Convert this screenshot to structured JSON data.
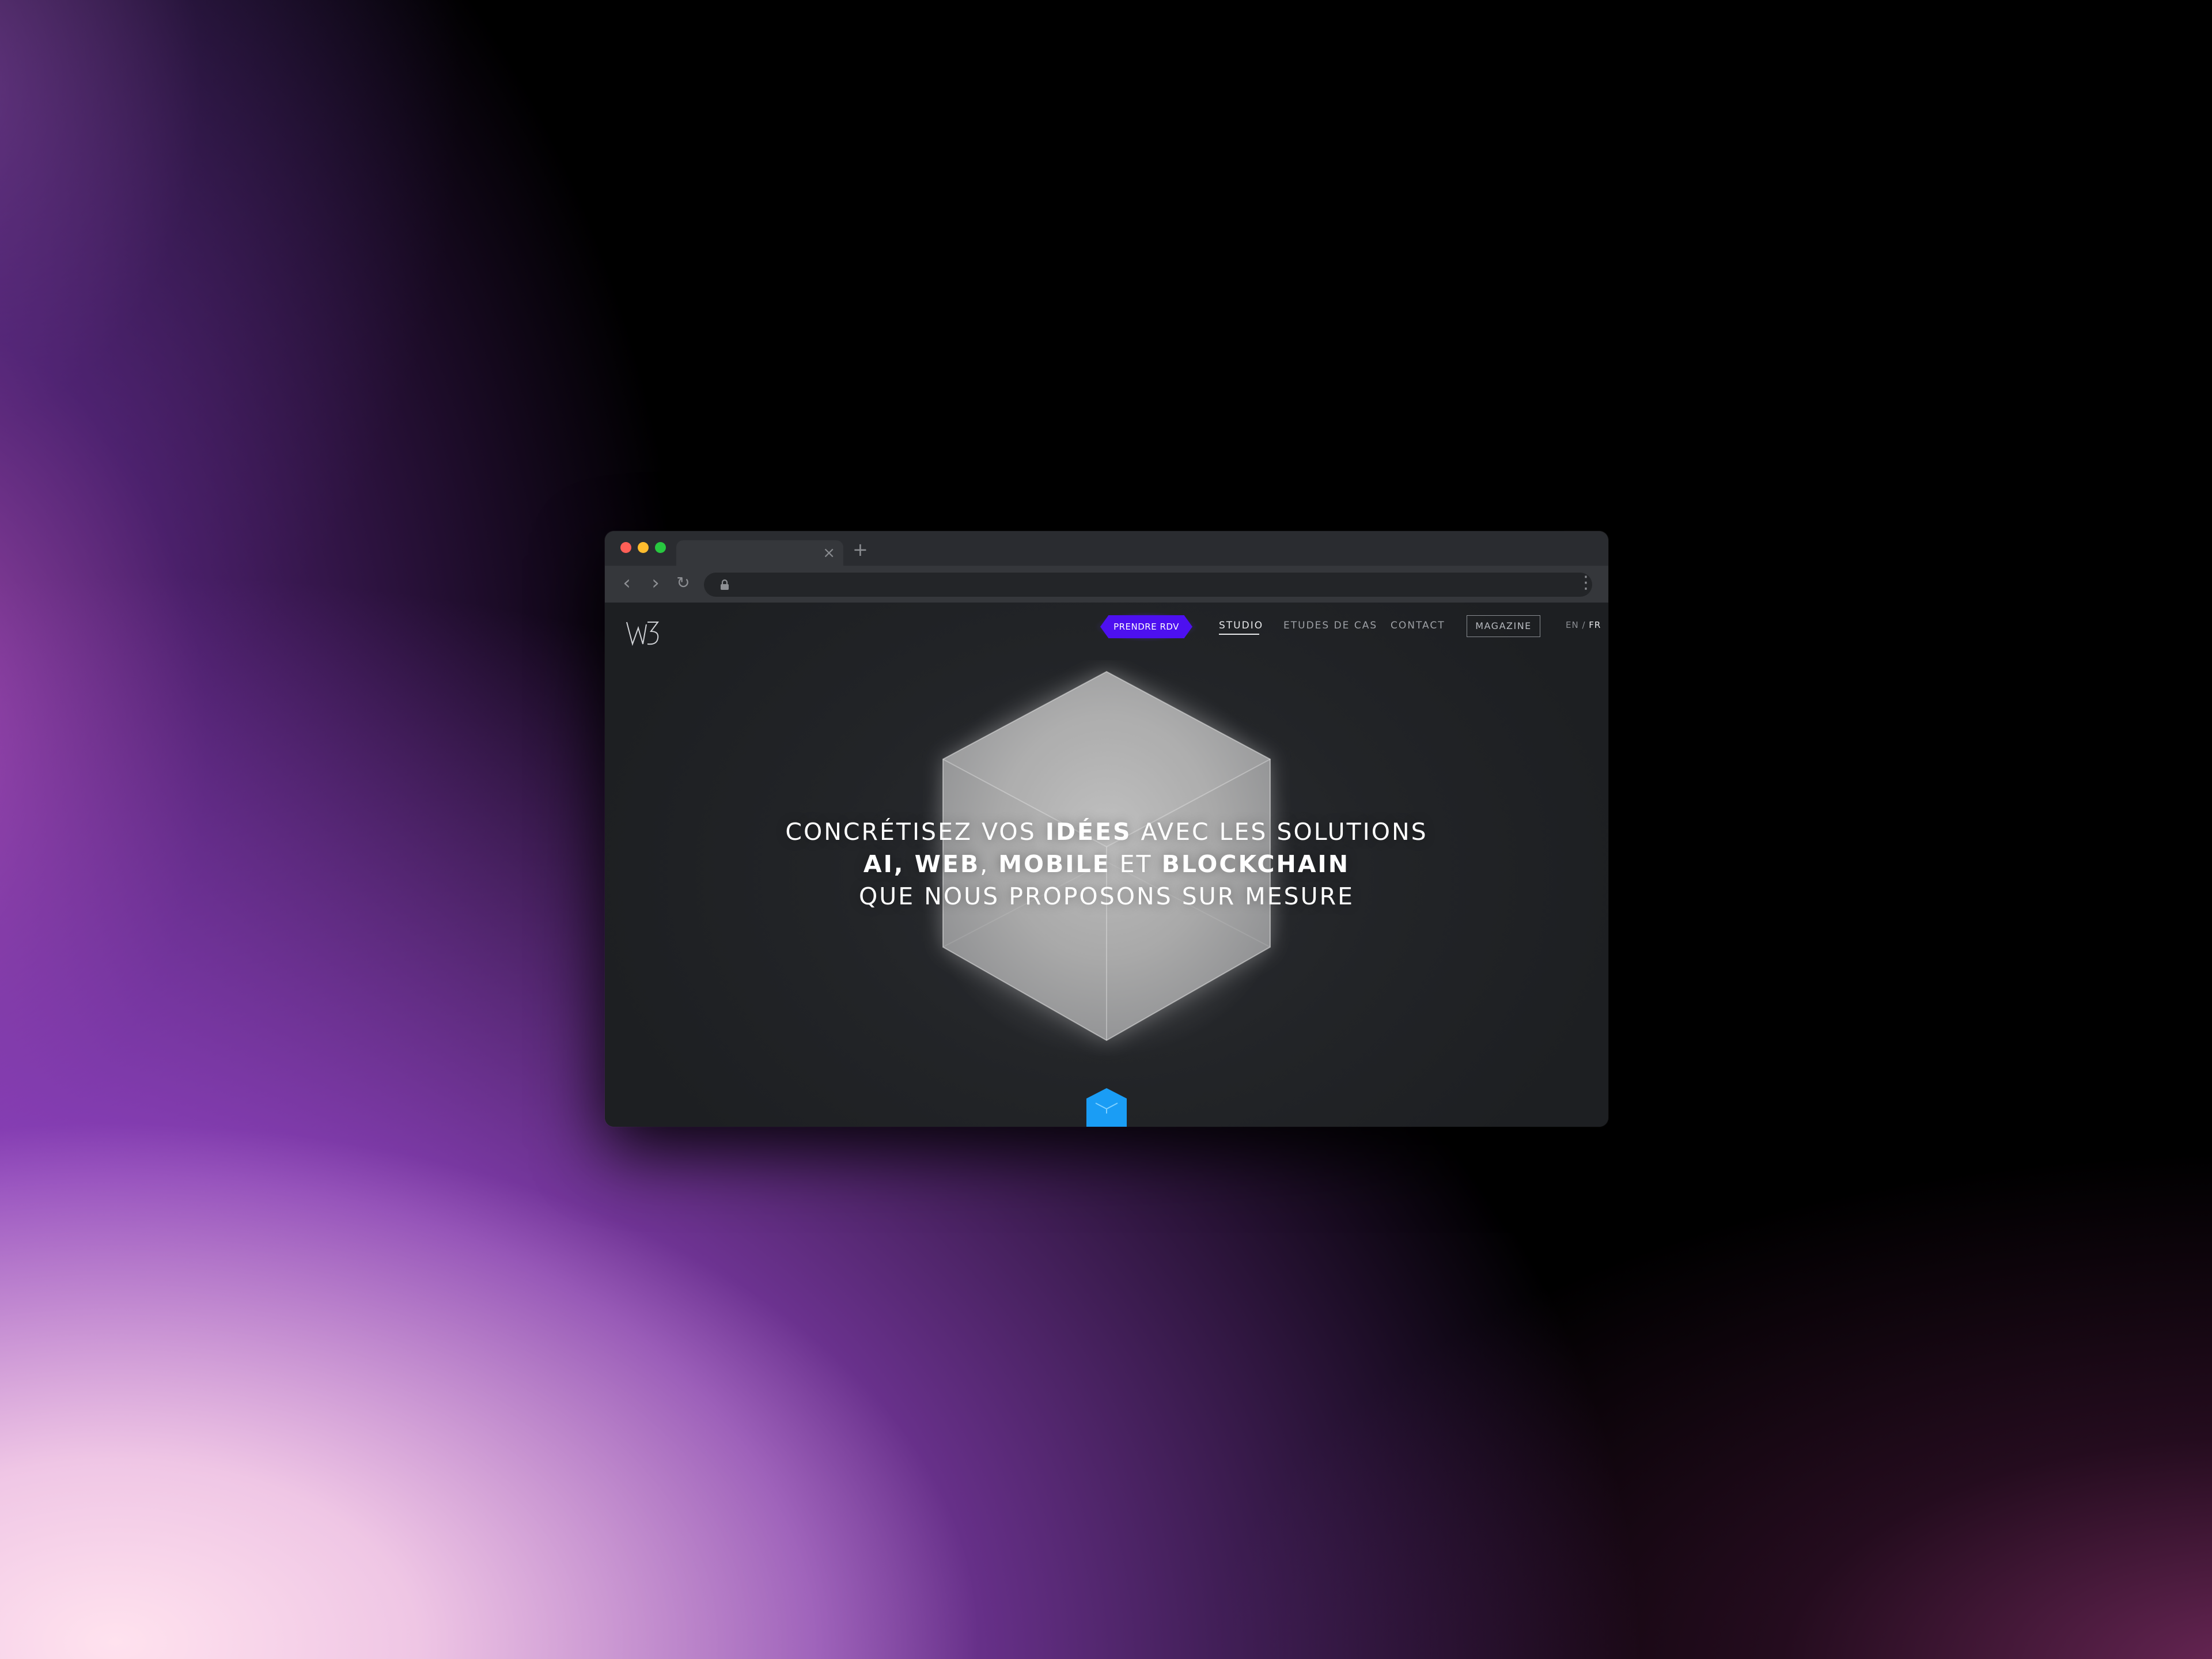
{
  "browser": {
    "tab_close": "×",
    "new_tab": "+",
    "back": "‹",
    "forward": "›",
    "reload": "↻",
    "menu": "⋮",
    "colors": {
      "close": "#ff5f57",
      "minimize": "#febc2e",
      "maximize": "#28c840"
    }
  },
  "site": {
    "logo_text": "w3",
    "nav": {
      "cta": "PRENDRE RDV",
      "studio": "STUDIO",
      "etudes": "ETUDES DE CAS",
      "contact": "CONTACT",
      "magazine": "MAGAZINE",
      "lang_en": "EN",
      "lang_sep": " / ",
      "lang_fr": "FR"
    },
    "hero": {
      "l1a": "CONCRÉTISEZ VOS ",
      "l1b": "IDÉES",
      "l1c": " AVEC LES SOLUTIONS",
      "l2a": "AI, WEB",
      "l2b": ", ",
      "l2c": "MOBILE",
      "l2d": " ET ",
      "l2e": "BLOCKCHAIN",
      "l3": "QUE NOUS PROPOSONS SUR MESURE"
    },
    "accent_color": "#4d10f0",
    "mini_cube_color": "#1a9df5"
  }
}
